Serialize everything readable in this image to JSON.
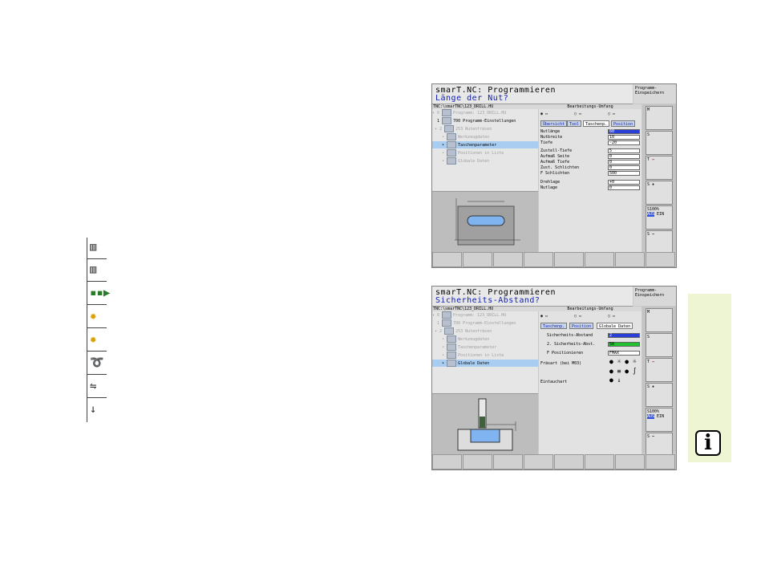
{
  "icon_column": [
    "drill-tool-icon",
    "drill-tool-icon-2",
    "forward-arrow-icon",
    "gear-star-icon",
    "gear-star-icon-2",
    "spring-helix-icon",
    "path-arrows-icon",
    "down-arrow-icon"
  ],
  "screen1": {
    "title": "smarT.NC: Programmieren",
    "prompt": "Länge der Nut?",
    "mode": "Programm-\nEinspeichern",
    "path": "TNC:\\smarTNC\\123_DRILL.HU",
    "form_header": "Bearbeitungs-Umfang",
    "tree": [
      {
        "label": "Programm: 123_DRILL.HU"
      },
      {
        "label": "700 Programm-Einstellungen"
      },
      {
        "label": "253 Nutenfräsen"
      },
      {
        "label": "Werkzeugdaten"
      },
      {
        "label": "Taschenparameter"
      },
      {
        "label": "Positionen in Liste"
      },
      {
        "label": "Globale Daten"
      }
    ],
    "tabs": [
      "Übersicht",
      "Tool",
      "Taschenp.",
      "Position"
    ],
    "fields": [
      {
        "label": "Nutlänge",
        "value": "60"
      },
      {
        "label": "Nutbreite",
        "value": "10"
      },
      {
        "label": "Tiefe",
        "value": "-20"
      },
      {
        "label": "Zustell-Tiefe",
        "value": "5"
      },
      {
        "label": "Aufmaß Seite",
        "value": "0"
      },
      {
        "label": "Aufmaß Tiefe",
        "value": "0"
      },
      {
        "label": "Zust. Schlichten",
        "value": "0"
      },
      {
        "label": "F Schlichten",
        "value": "500"
      },
      {
        "label": "Drehlage",
        "value": "+0"
      },
      {
        "label": "Nutlage",
        "value": "0"
      }
    ],
    "side_buttons": [
      "M",
      "S",
      "T",
      "S",
      "S100%",
      "S"
    ],
    "side_labels": {
      "aus": "AUS",
      "ein": "EIN"
    }
  },
  "screen2": {
    "title": "smarT.NC: Programmieren",
    "prompt": "Sicherheits-Abstand?",
    "mode": "Programm-\nEinspeichern",
    "path": "TNC:\\smarTNC\\123_DRILL.HU",
    "form_header": "Bearbeitungs-Umfang",
    "tree": [
      {
        "label": "Programm: 123_DRILL.HU"
      },
      {
        "label": "700 Programm-Einstellungen"
      },
      {
        "label": "253 Nutenfräsen"
      },
      {
        "label": "Werkzeugdaten"
      },
      {
        "label": "Taschenparameter"
      },
      {
        "label": "Positionen in Liste"
      },
      {
        "label": "Globale Daten"
      }
    ],
    "tabs": [
      "Taschenp.",
      "Position",
      "Globale Daten"
    ],
    "fields": [
      {
        "label": "Sicherheits-Abstand",
        "value": "2"
      },
      {
        "label": "2. Sicherheits-Abst.",
        "value": "50"
      },
      {
        "label": "F Positionieren",
        "value": "FMAX"
      },
      {
        "label": "Fräsart (bei M03)",
        "value": ""
      },
      {
        "label": "Eintauchart",
        "value": ""
      }
    ]
  },
  "info_icon": "i",
  "colors": {
    "info_panel": "#eef5d2",
    "selected": "#a9cdf0",
    "field_blue": "#2a3ed8",
    "field_green": "#20c030"
  }
}
